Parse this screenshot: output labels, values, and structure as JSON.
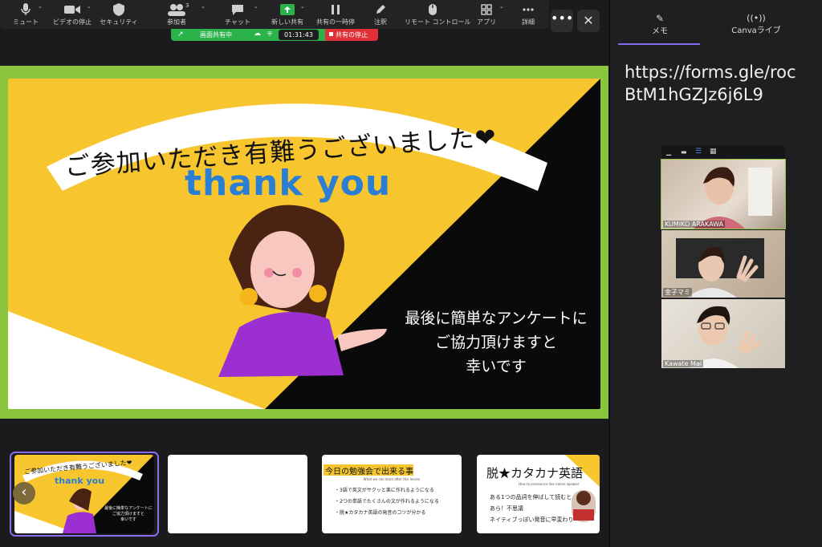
{
  "toolbar": {
    "items": [
      {
        "label": "ミュート",
        "icon": "mic-icon"
      },
      {
        "label": "ビデオの停止",
        "icon": "video-icon"
      },
      {
        "label": "セキュリティ",
        "icon": "shield-icon"
      },
      {
        "label": "参加者",
        "icon": "participants-icon",
        "count": "3"
      },
      {
        "label": "チャット",
        "icon": "chat-icon"
      },
      {
        "label": "新しい共有",
        "icon": "share-icon"
      },
      {
        "label": "共有の一時停",
        "icon": "pause-icon"
      },
      {
        "label": "注釈",
        "icon": "pen-icon"
      },
      {
        "label": "リモート コントロール",
        "icon": "mouse-icon"
      },
      {
        "label": "アプリ",
        "icon": "apps-icon"
      },
      {
        "label": "詳細",
        "icon": "more-icon"
      }
    ],
    "more_label": "•••",
    "close_label": "✕"
  },
  "share_bar": {
    "status": "画面共有中",
    "timer": "01:31:43",
    "stop_label": "共有の停止"
  },
  "slide": {
    "banner_text": "ご参加いただき有難うございました❤",
    "thanks_text": "thank you",
    "message_lines": [
      "最後に簡単なアンケートに",
      "ご協力頂けますと",
      "幸いです"
    ]
  },
  "side_panel": {
    "tabs": [
      {
        "label": "メモ",
        "icon": "memo-icon"
      },
      {
        "label": "Canvaライブ",
        "icon": "broadcast-icon"
      }
    ],
    "url_lines": [
      "https://forms.gle/roc",
      "BtM1hGZJz6j6L9"
    ]
  },
  "participants": [
    {
      "name": "KUMIKO ARAKAWA"
    },
    {
      "name": "金子マミ"
    },
    {
      "name": "Kawate Mai"
    }
  ],
  "thumbnails": [
    {
      "banner": "ご参加いただき有難うございました❤",
      "thanks": "thank you",
      "lines": [
        "最後に簡単なアンケートに",
        "ご協力頂けますと",
        "幸いです"
      ]
    },
    {},
    {
      "title": "今日の勉強会で出来る事",
      "subtitle": "What we can learn after this lesson",
      "bullets": [
        "・3語で英文がサクッと楽に作れるようになる",
        "・2つの単語でたくさんの文が作れるようになる",
        "・脱★カタカナ英語の発音のコツが分かる"
      ]
    },
    {
      "title": "脱★カタカナ英語",
      "subtitle": "How to pronounce like native speaker",
      "lines": [
        "ある1つの品詞を伸ばして読むと",
        "あら！不思議",
        "ネイティブっぽい発音に早変わり"
      ]
    }
  ],
  "nav": {
    "prev_label": "‹"
  },
  "colors": {
    "accent_green": "#8bc53f",
    "share_green": "#2bb24a",
    "stop_red": "#e02f36",
    "slide_yellow": "#f7c62f",
    "thanks_blue": "#2a7fd4",
    "tab_underline": "#7e6cf0"
  }
}
